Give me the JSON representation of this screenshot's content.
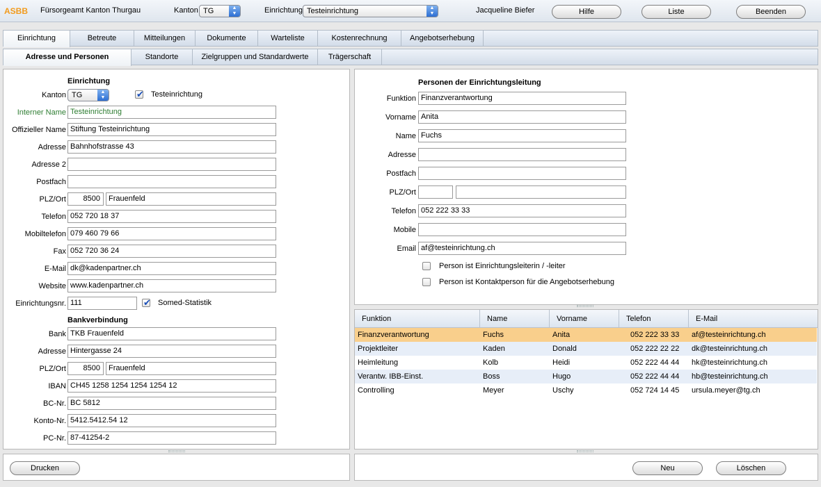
{
  "app": {
    "logo": "ASBB",
    "office": "Fürsorgeamt Kanton Thurgau",
    "kanton_label": "Kanton",
    "kanton_value": "TG",
    "einrichtung_label": "Einrichtung",
    "einrichtung_value": "Testeinrichtung",
    "user": "Jacqueline Biefer",
    "buttons": {
      "help": "Hilfe",
      "list": "Liste",
      "quit": "Beenden"
    }
  },
  "main_tabs": [
    "Einrichtung",
    "Betreute",
    "Mitteilungen",
    "Dokumente",
    "Warteliste",
    "Kostenrechnung",
    "Angebotserhebung"
  ],
  "sub_tabs": [
    "Adresse und Personen",
    "Standorte",
    "Zielgruppen und Standardwerte",
    "Trägerschaft"
  ],
  "left": {
    "title": "Einrichtung",
    "kanton_label": "Kanton",
    "kanton_value": "TG",
    "test_label": "Testeinrichtung",
    "fields": {
      "interner_name": {
        "label": "Interner Name",
        "value": "Testeinrichtung"
      },
      "offizieller_name": {
        "label": "Offizieller Name",
        "value": "Stiftung Testeinrichtung"
      },
      "adresse": {
        "label": "Adresse",
        "value": "Bahnhofstrasse 43"
      },
      "adresse2": {
        "label": "Adresse 2",
        "value": ""
      },
      "postfach": {
        "label": "Postfach",
        "value": ""
      },
      "plzort": {
        "label": "PLZ/Ort",
        "plz": "8500",
        "ort": "Frauenfeld"
      },
      "telefon": {
        "label": "Telefon",
        "value": "052 720 18 37"
      },
      "mobil": {
        "label": "Mobiltelefon",
        "value": "079 460 79 66"
      },
      "fax": {
        "label": "Fax",
        "value": "052 720 36 24"
      },
      "email": {
        "label": "E-Mail",
        "value": "dk@kadenpartner.ch"
      },
      "website": {
        "label": "Website",
        "value": "www.kadenpartner.ch"
      },
      "nr": {
        "label": "Einrichtungsnr.",
        "value": "111"
      }
    },
    "somed_label": "Somed-Statistik",
    "bank_title": "Bankverbindung",
    "bank": {
      "bank": {
        "label": "Bank",
        "value": "TKB Frauenfeld"
      },
      "adresse": {
        "label": "Adresse",
        "value": "Hintergasse 24"
      },
      "plzort": {
        "label": "PLZ/Ort",
        "plz": "8500",
        "ort": "Frauenfeld"
      },
      "iban": {
        "label": "IBAN",
        "value": "CH45 1258 1254 1254 1254 12"
      },
      "bc": {
        "label": "BC-Nr.",
        "value": "BC 5812"
      },
      "konto": {
        "label": "Konto-Nr.",
        "value": "5412.5412.54 12"
      },
      "pc": {
        "label": "PC-Nr.",
        "value": "87-41254-2"
      }
    },
    "print_button": "Drucken"
  },
  "right": {
    "title": "Personen der Einrichtungsleitung",
    "fields": {
      "funktion": {
        "label": "Funktion",
        "value": "Finanzverantwortung"
      },
      "vorname": {
        "label": "Vorname",
        "value": "Anita"
      },
      "name": {
        "label": "Name",
        "value": "Fuchs"
      },
      "adresse": {
        "label": "Adresse",
        "value": ""
      },
      "postfach": {
        "label": "Postfach",
        "value": ""
      },
      "plzort": {
        "label": "PLZ/Ort",
        "plz": "",
        "ort": ""
      },
      "telefon": {
        "label": "Telefon",
        "value": "052 222 33 33"
      },
      "mobile": {
        "label": "Mobile",
        "value": ""
      },
      "email": {
        "label": "Email",
        "value": "af@testeinrichtung.ch"
      }
    },
    "check_leiter": "Person ist Einrichtungsleiterin / -leiter",
    "check_kontakt": "Person ist Kontaktperson für die Angebotserhebung",
    "table": {
      "columns": [
        "Funktion",
        "Name",
        "Vorname",
        "Telefon",
        "E-Mail"
      ],
      "rows": [
        [
          "Finanzverantwortung",
          "Fuchs",
          "Anita",
          "052 222 33 33",
          "af@testeinrichtung.ch"
        ],
        [
          "Projektleiter",
          "Kaden",
          "Donald",
          "052 222 22 22",
          "dk@testeinrichtung.ch"
        ],
        [
          "Heimleitung",
          "Kolb",
          "Heidi",
          "052 222 44 44",
          "hk@testeinrichtung.ch"
        ],
        [
          "Verantw. IBB-Einst.",
          "Boss",
          "Hugo",
          "052 222 44 44",
          "hb@testeinrichtung.ch"
        ],
        [
          "Controlling",
          "Meyer",
          "Uschy",
          "052 724 14 45",
          "ursula.meyer@tg.ch"
        ]
      ],
      "selected_row": 0
    },
    "new_button": "Neu",
    "delete_button": "Löschen"
  },
  "colors": {
    "accent": "#f29b1d",
    "selected_row": "#f9cf8c",
    "alt_row": "#e7eef8",
    "green_label": "#2e7d32"
  }
}
